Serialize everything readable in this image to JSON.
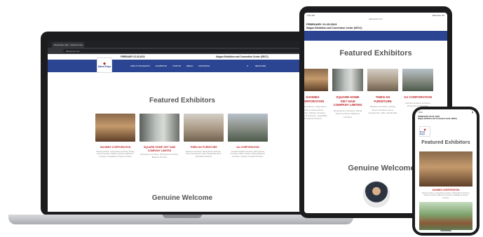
{
  "laptop": {
    "tab_title": "Dana Expo Site - Vietnam Inte...",
    "url": "danaexpo.com",
    "date": "FEBRUARY 22-25,2023",
    "venue": "Saigon Exhibition and Convention Center (SECC)",
    "logo_name": "Dana Expo",
    "nav": [
      "ABOUT DANAEXPO",
      "EXHIBITOR",
      "VISITOR",
      "MEDIA",
      "PROGRAM"
    ],
    "register": "REGISTER",
    "section_title": "Featured Exhibitors",
    "exhibitors": [
      {
        "name": "SAVIMEX CORPORATION",
        "desc": "Dining Furniture, Living Room Furniture, Dining Room Furniture, Kitchen Furniture, Bathroom Furniture, Hospitality & Project Furniture"
      },
      {
        "name": "SQUARE HOME VIET NAM COMPANY LIMITED",
        "desc": "Dining Room Furniture, Dining Room Furniture, Bedroom Furniture"
      },
      {
        "name": "THIEN AN FURNITURE",
        "desc": "Bedroom Furniture, Dining Room Furniture, Home Accessories, Gifts, Handicrafts Home Decoration Products"
      },
      {
        "name": "AA CORPORATION",
        "desc": "Contract Outdoor Furniture, Dining Room Furniture, Office, Kitchen, Dining, Bedroom Furniture, Outdoor & Garden Furniture"
      }
    ],
    "welcome": "Genuine Welcome"
  },
  "tablet": {
    "status_time": "9:41 AM",
    "status_date": "Wed Nov 7th",
    "url": "danaexpo.com",
    "date": "FEBRUARY 22-25,2023",
    "venue": "Saigon Exhibition and Convention Center (SECC)",
    "section_title": "Featured Exhibitors",
    "exhibitors": [
      {
        "name": "SAVIMEX CORPORATION",
        "desc": "Dining Furniture, Living Room Furniture, Dining Room Furniture, Kitchen Furniture, Bathroom Furniture, Hospitality & Project Furniture"
      },
      {
        "name": "SQUARE HOME VIET NAM COMPANY LIMITED",
        "desc": "Dining Room Furniture, Dining Room Furniture, Bedroom Furniture"
      },
      {
        "name": "THIEN AN FURNITURE",
        "desc": "Bedroom Furniture, Dining Room Furniture, Home Accessories, Gifts, Handicrafts"
      },
      {
        "name": "AA CORPORATION",
        "desc": "Contract Outdoor Furniture, Dining Room Furniture"
      }
    ],
    "welcome": "Genuine Welcome"
  },
  "phone": {
    "status_time": "9:41",
    "date": "FEBRUARY 22-25, 2023",
    "venue": "Saigon Exhibition and Convention Center (SECC)",
    "logo_name": "Dana Expo",
    "section_title": "Featured Exhibitors",
    "exhibitor_name": "SAVIMEX CORPORATION",
    "exhibitor_desc": "Dining Furniture, Living Room Furniture, Dining Room Furniture, Kitchen Furniture, Bathroom Furniture, Hospitality & Project Furniture"
  }
}
